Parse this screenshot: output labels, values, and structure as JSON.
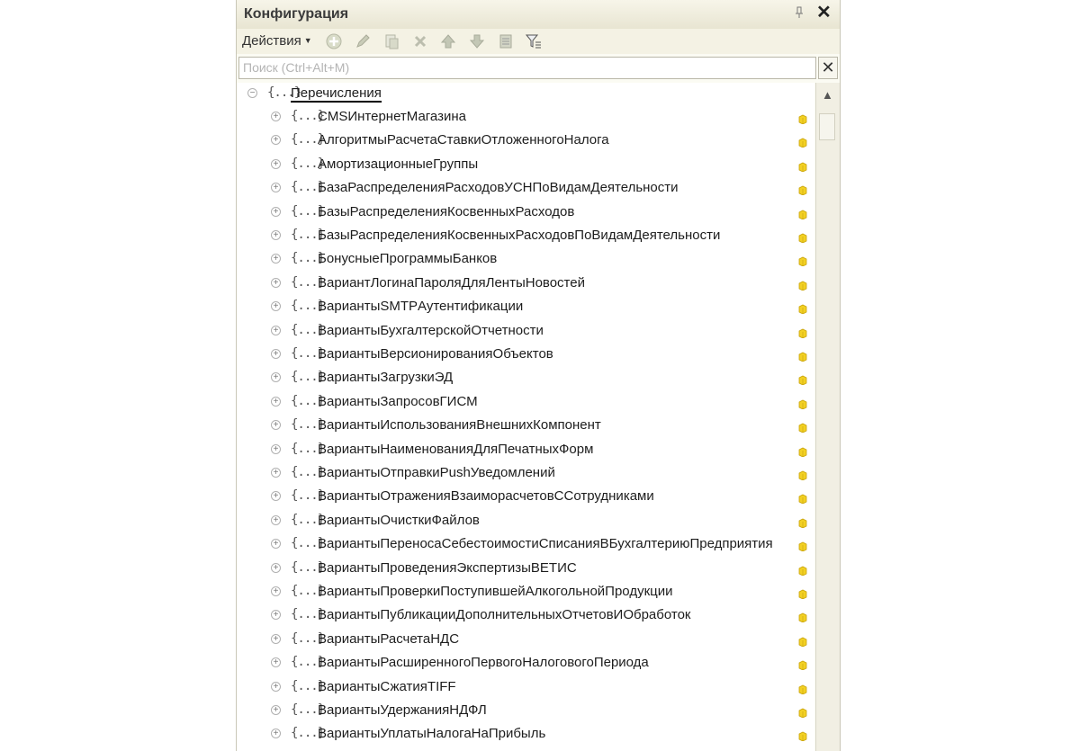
{
  "window": {
    "title": "Конфигурация"
  },
  "toolbar": {
    "actions_label": "Действия"
  },
  "search": {
    "placeholder": "Поиск (Ctrl+Alt+M)"
  },
  "tree": {
    "root_label": "Перечисления",
    "items": [
      "CMSИнтернетМагазина",
      "АлгоритмыРасчетаСтавкиОтложенногоНалога",
      "АмортизационныеГруппы",
      "БазаРаспределенияРасходовУСНПоВидамДеятельности",
      "БазыРаспределенияКосвенныхРасходов",
      "БазыРаспределенияКосвенныхРасходовПоВидамДеятельности",
      "БонусныеПрограммыБанков",
      "ВариантЛогинаПароляДляЛентыНовостей",
      "ВариантыSMTPАутентификации",
      "ВариантыБухгалтерскойОтчетности",
      "ВариантыВерсионированияОбъектов",
      "ВариантыЗагрузкиЭД",
      "ВариантыЗапросовГИСМ",
      "ВариантыИспользованияВнешнихКомпонент",
      "ВариантыНаименованияДляПечатныхФорм",
      "ВариантыОтправкиPushУведомлений",
      "ВариантыОтраженияВзаиморасчетовССотрудниками",
      "ВариантыОчисткиФайлов",
      "ВариантыПереносаСебестоимостиСписанияВБухгалтериюПредприятия",
      "ВариантыПроведенияЭкспертизыВЕТИС",
      "ВариантыПроверкиПоступившейАлкогольнойПродукции",
      "ВариантыПубликацииДополнительныхОтчетовИОбработок",
      "ВариантыРасчетаНДС",
      "ВариантыРасширенногоПервогоНалоговогоПериода",
      "ВариантыСжатияTIFF",
      "ВариантыУдержанияНДФЛ",
      "ВариантыУплатыНалогаНаПрибыль"
    ]
  },
  "colors": {
    "panel_bg": "#fbfbf3",
    "marker": "#e8c21c",
    "title_bar": "#e8e5d2"
  }
}
